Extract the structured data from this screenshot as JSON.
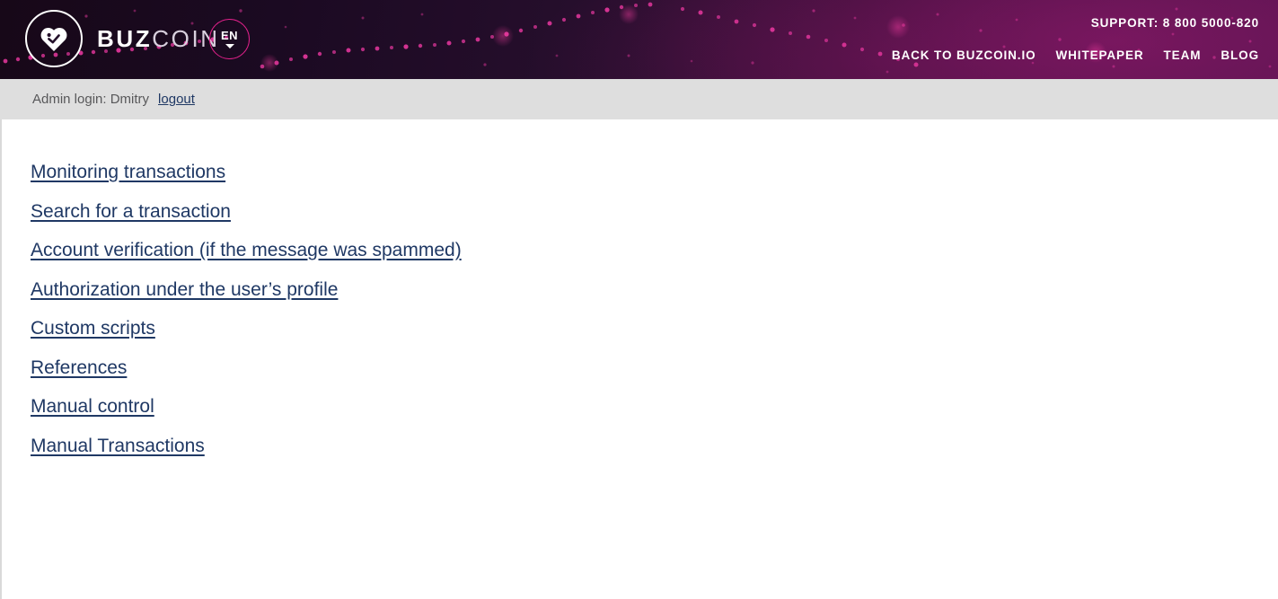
{
  "header": {
    "brand": {
      "logo_icon": "heart-circle-logo-icon",
      "wordmark_bold": "BUZ",
      "wordmark_light": "COIN"
    },
    "language_switcher": {
      "label": "EN",
      "caret_icon": "chevron-down-icon"
    },
    "support": "SUPPORT: 8 800 5000-820",
    "nav": [
      {
        "label": "BACK TO BUZCOIN.IO"
      },
      {
        "label": "WHITEPAPER"
      },
      {
        "label": "TEAM"
      },
      {
        "label": "BLOG"
      }
    ],
    "colors": {
      "bg_dark": "#170818",
      "bg_magenta": "#5a1552",
      "accent_pink": "#e0218a",
      "text": "#ffffff"
    }
  },
  "admin_bar": {
    "login_text": "Admin login: Dmitry",
    "logout_label": "logout",
    "background": "#dedede",
    "text_color": "#58585a",
    "link_color": "#1f3864"
  },
  "main": {
    "link_color": "#1f3864",
    "links": [
      {
        "label": "Monitoring transactions"
      },
      {
        "label": "Search for a transaction"
      },
      {
        "label": "Account verification (if the message was spammed)"
      },
      {
        "label": "Authorization under the user’s profile"
      },
      {
        "label": "Custom scripts"
      },
      {
        "label": "References"
      },
      {
        "label": "Manual control"
      },
      {
        "label": "Manual Transactions"
      }
    ]
  }
}
